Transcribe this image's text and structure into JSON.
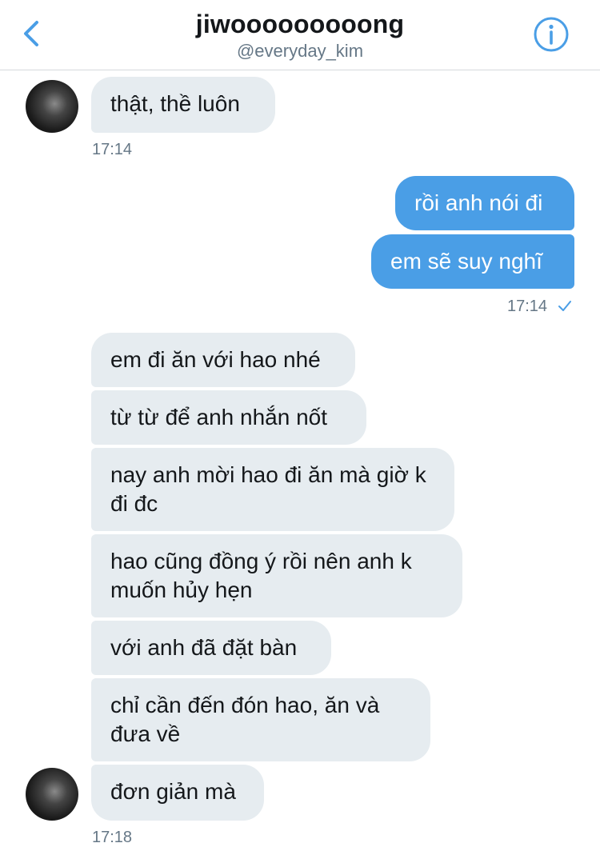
{
  "header": {
    "title": "jiwooooooooong",
    "handle": "@everyday_kim",
    "back_icon": "chevron-left-icon",
    "info_icon": "info-icon",
    "accent_color": "#4a9ee6"
  },
  "conversation": {
    "messages": [
      {
        "from": "them",
        "text": "thật, thề luôn"
      },
      {
        "from": "me",
        "text": "rồi anh nói đi"
      },
      {
        "from": "me",
        "text": "em sẽ suy nghĩ"
      },
      {
        "from": "them",
        "text": "em đi ăn với hao nhé"
      },
      {
        "from": "them",
        "text": "từ từ để anh nhắn nốt"
      },
      {
        "from": "them",
        "text": "nay anh mời hao đi ăn mà giờ k đi đc"
      },
      {
        "from": "them",
        "text": "hao cũng đồng ý rồi nên anh k muốn hủy hẹn"
      },
      {
        "from": "them",
        "text": "với anh đã đặt bàn"
      },
      {
        "from": "them",
        "text": "chỉ cần đến đón hao, ăn và đưa về"
      },
      {
        "from": "them",
        "text": "đơn giản mà"
      }
    ],
    "timestamps": [
      "17:14",
      "17:14",
      "17:18"
    ],
    "read_receipt_icon": "checkmark-icon",
    "colors": {
      "incoming_bubble": "#e6ecf0",
      "outgoing_bubble": "#4a9ee6"
    }
  }
}
